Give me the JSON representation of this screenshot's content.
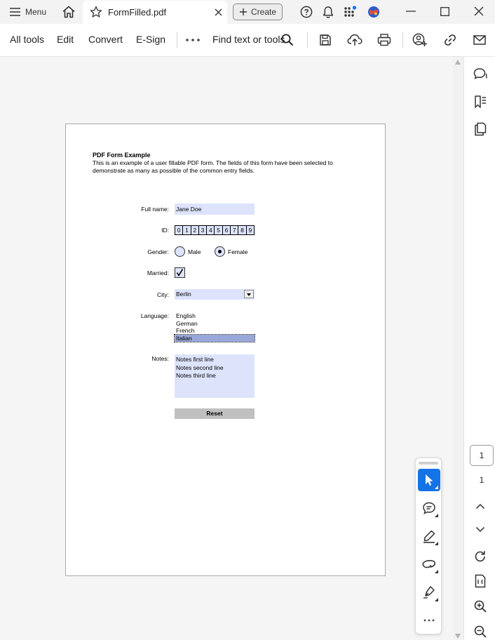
{
  "titlebar": {
    "menu_label": "Menu",
    "tab_title": "FormFilled.pdf",
    "create_label": "Create"
  },
  "toolbar": {
    "items": [
      "All tools",
      "Edit",
      "Convert",
      "E-Sign"
    ],
    "search_label": "Find text or tools"
  },
  "form": {
    "title": "PDF Form Example",
    "description": "This is an example of a user fillable PDF form. The fields of this form have been selected to demonstrate as many as possible of the common entry fields.",
    "labels": {
      "full_name": "Full name:",
      "id": "ID:",
      "gender": "Gender:",
      "married": "Married:",
      "city": "City:",
      "language": "Language:",
      "notes": "Notes:"
    },
    "full_name": "Jane Doe",
    "id_digits": [
      "0",
      "1",
      "2",
      "3",
      "4",
      "5",
      "6",
      "7",
      "8",
      "9"
    ],
    "gender_options": [
      "Male",
      "Female"
    ],
    "gender_selected": "Female",
    "married": true,
    "city": "Berlin",
    "languages": [
      "English",
      "German",
      "French",
      "Italian"
    ],
    "language_selected": "Italian",
    "notes": [
      "Notes first line",
      "Notes second line",
      "Notes third line"
    ],
    "reset_label": "Reset"
  },
  "navigation": {
    "current_page": "1",
    "total_pages": "1"
  },
  "colors": {
    "accent": "#1473e6",
    "field_fill": "#dde3fb",
    "notification_dot": "#1473e6"
  }
}
